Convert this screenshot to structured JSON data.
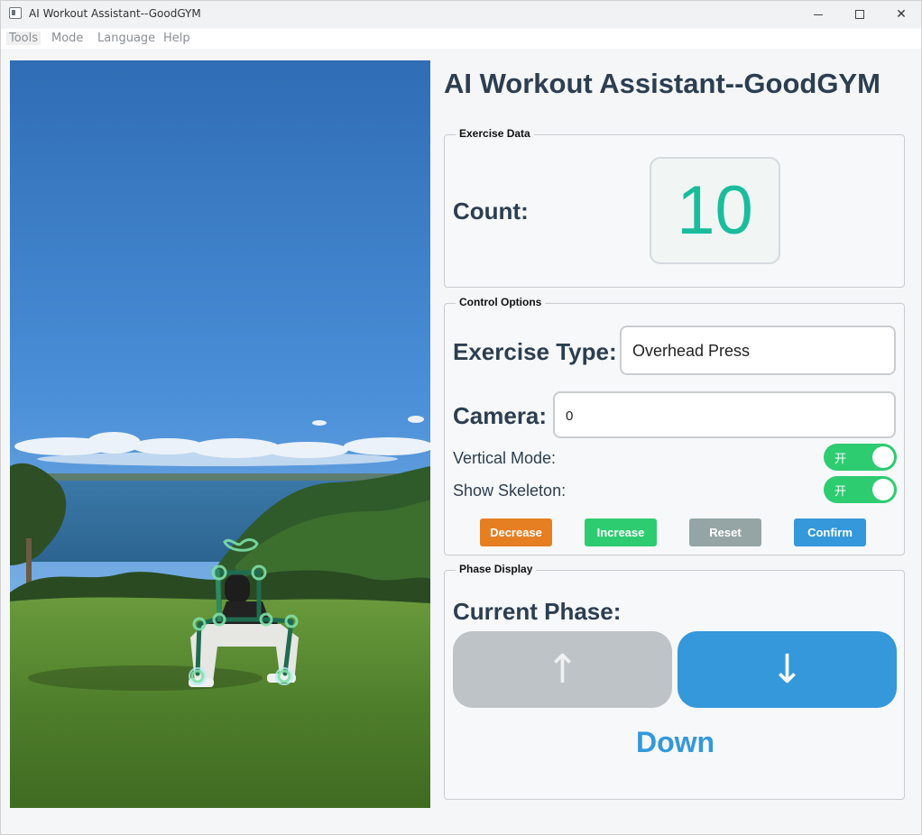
{
  "window": {
    "title": "AI Workout Assistant--GoodGYM",
    "minimize_glyph": "",
    "close_glyph": "✕"
  },
  "menu": {
    "items": [
      "Tools",
      "Mode",
      "Language",
      "Help"
    ]
  },
  "main": {
    "title": "AI Workout Assistant--GoodGYM"
  },
  "exercise_data": {
    "group_title": "Exercise Data",
    "count_label": "Count:",
    "count_value": "10"
  },
  "control_options": {
    "group_title": "Control Options",
    "exercise_type_label": "Exercise Type:",
    "exercise_type_value": "Overhead Press",
    "camera_label": "Camera:",
    "camera_value": "0",
    "vertical_mode_label": "Vertical Mode:",
    "vertical_mode_on": true,
    "vertical_mode_text": "开",
    "show_skeleton_label": "Show Skeleton:",
    "show_skeleton_on": true,
    "show_skeleton_text": "开",
    "buttons": {
      "decrease": "Decrease",
      "increase": "Increase",
      "reset": "Reset",
      "confirm": "Confirm"
    }
  },
  "phase_display": {
    "group_title": "Phase Display",
    "current_phase_label": "Current Phase:",
    "up_arrow": "↑",
    "down_arrow": "↓",
    "active_phase": "down",
    "phase_text": "Down"
  },
  "colors": {
    "title": "#2c3e50",
    "count": "#1abc9c",
    "decrease": "#e67e22",
    "increase": "#2ecc71",
    "reset": "#95a5a6",
    "confirm": "#3498db",
    "phase_inactive": "#bdc3c7",
    "phase_active": "#3498db",
    "toggle_on": "#2ecc71"
  }
}
